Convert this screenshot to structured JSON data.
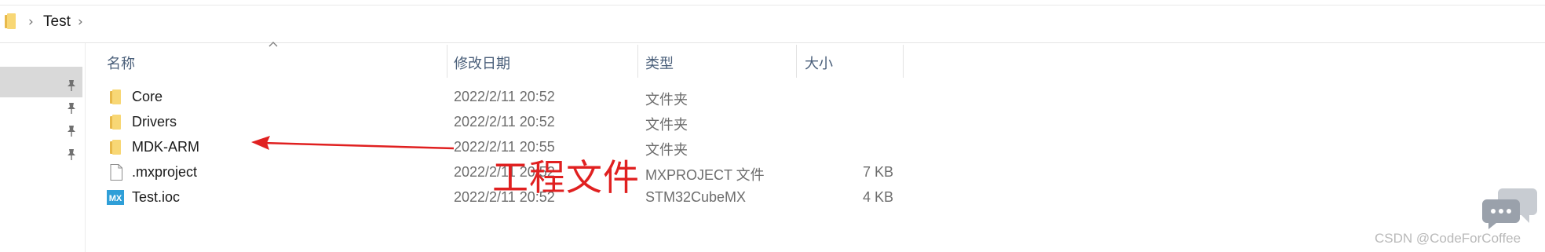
{
  "breadcrumb": {
    "items": [
      "Test"
    ]
  },
  "columns": {
    "name": "名称",
    "modified": "修改日期",
    "type": "类型",
    "size": "大小"
  },
  "files": [
    {
      "name": "Core",
      "modified": "2022/2/11 20:52",
      "type": "文件夹",
      "size": "",
      "icon": "folder-icon"
    },
    {
      "name": "Drivers",
      "modified": "2022/2/11 20:52",
      "type": "文件夹",
      "size": "",
      "icon": "folder-icon"
    },
    {
      "name": "MDK-ARM",
      "modified": "2022/2/11 20:55",
      "type": "文件夹",
      "size": "",
      "icon": "folder-icon"
    },
    {
      "name": ".mxproject",
      "modified": "2022/2/11 20:52",
      "type": "MXPROJECT 文件",
      "size": "7 KB",
      "icon": "file-icon"
    },
    {
      "name": "Test.ioc",
      "modified": "2022/2/11 20:52",
      "type": "STM32CubeMX",
      "size": "4 KB",
      "icon": "stm32cubemx-icon"
    }
  ],
  "annotation": {
    "text": "工程文件",
    "color": "#e02020"
  },
  "watermark": {
    "text": "CSDN @CodeForCoffee"
  },
  "colors": {
    "header_text": "#4a5f7a",
    "folder_yellow": "#f8d775",
    "mx_blue": "#2f9fd8",
    "nav_selected": "#d9d9d9"
  }
}
